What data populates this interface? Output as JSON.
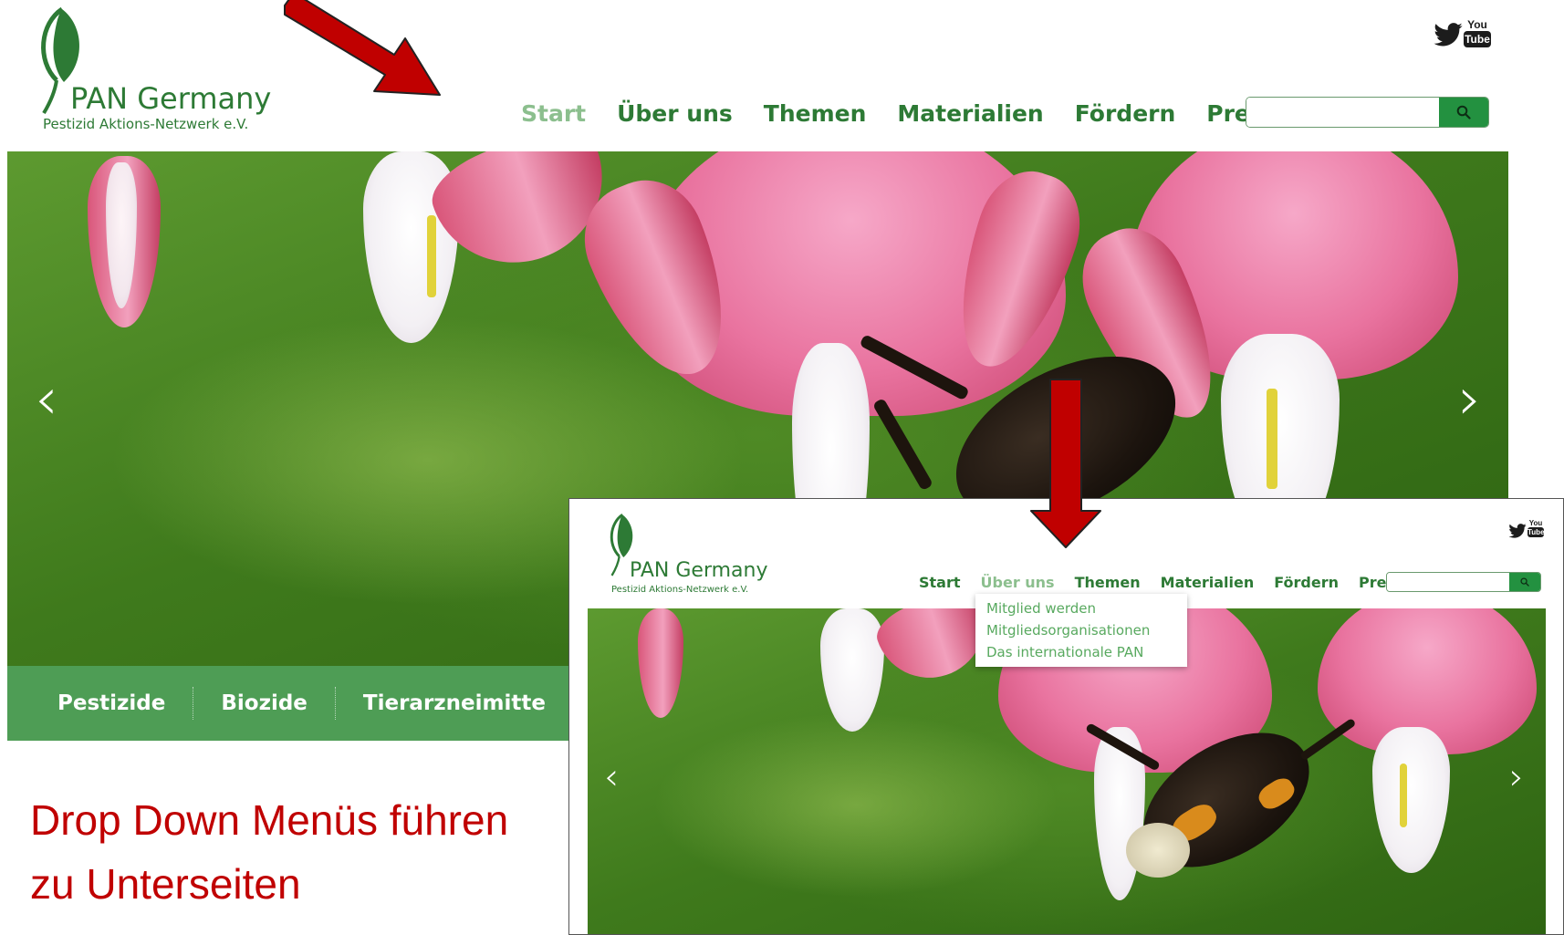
{
  "logo": {
    "name": "PAN Germany",
    "subtitle": "Pestizid Aktions-Netzwerk e.V."
  },
  "social": {
    "twitter_icon": "twitter-bird-icon",
    "youtube_you": "You",
    "youtube_tube": "Tube"
  },
  "nav": {
    "items": [
      "Start",
      "Über uns",
      "Themen",
      "Materialien",
      "Fördern",
      "Presse"
    ],
    "active": "Start",
    "search_placeholder": "",
    "search_icon": "search-icon"
  },
  "slider": {
    "prev": "‹",
    "next": "›"
  },
  "categories": [
    "Pestizide",
    "Biozide",
    "Tierarzneimitte"
  ],
  "caption": {
    "line1": "Drop Down Menüs führen",
    "line2": "zu Unterseiten"
  },
  "inset": {
    "nav_items": [
      "Start",
      "Über uns",
      "Themen",
      "Materialien",
      "Fördern",
      "Presse"
    ],
    "active": "Über uns",
    "dropdown": [
      "Mitglied werden",
      "Mitgliedsorganisationen",
      "Das internationale PAN"
    ]
  },
  "colors": {
    "brand_green": "#2d7a35",
    "category_bar": "#4e9d55",
    "search_button": "#239140",
    "annotation_red": "#c00000",
    "arrow_red": "#c00000"
  }
}
